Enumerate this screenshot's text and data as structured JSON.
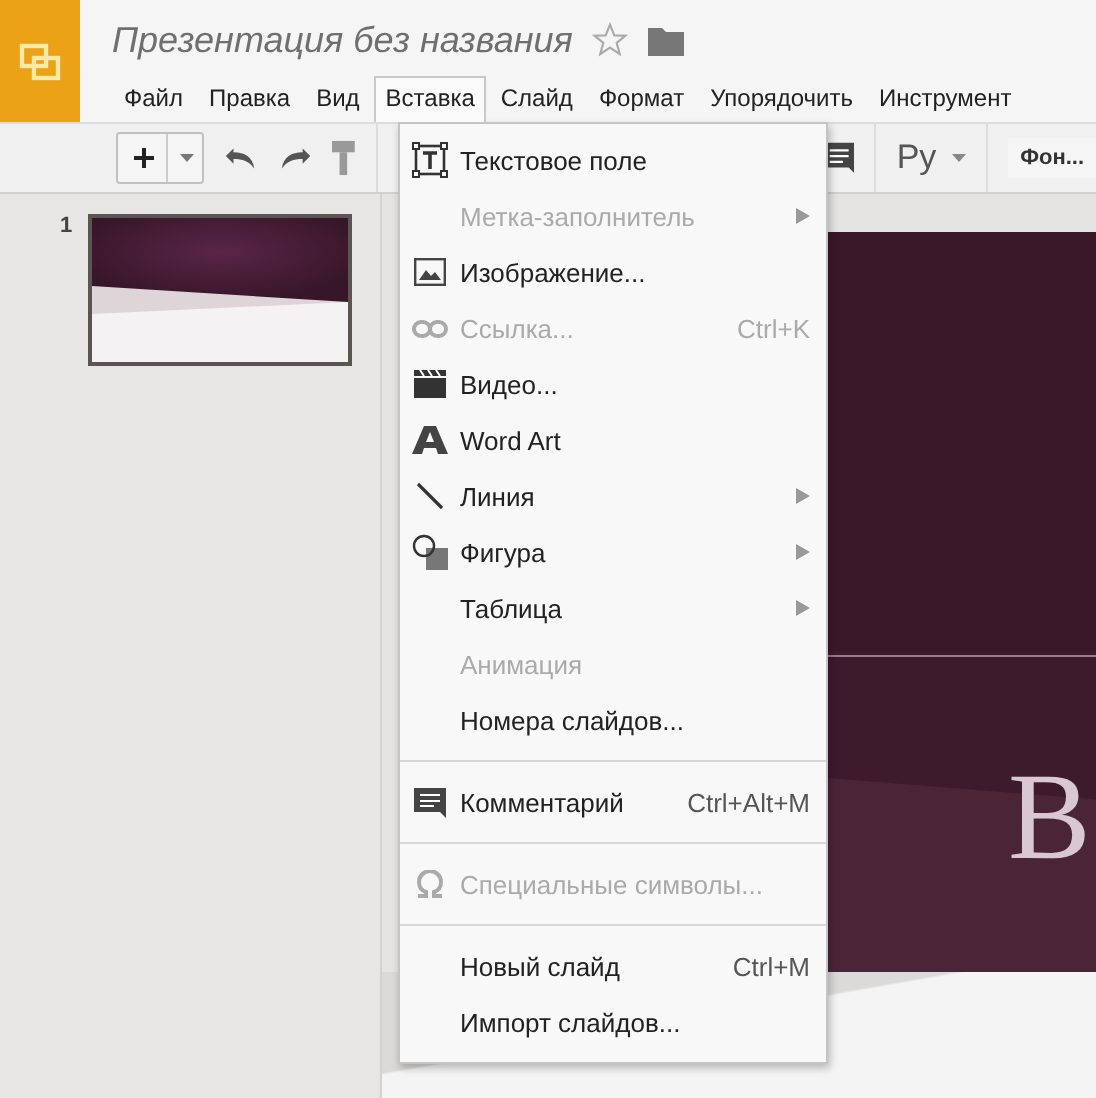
{
  "document": {
    "title": "Презентация без названия",
    "starred": false
  },
  "menu_bar": [
    {
      "label": "Файл",
      "selected": false
    },
    {
      "label": "Правка",
      "selected": false
    },
    {
      "label": "Вид",
      "selected": false
    },
    {
      "label": "Вставка",
      "selected": true
    },
    {
      "label": "Слайд",
      "selected": false
    },
    {
      "label": "Формат",
      "selected": false
    },
    {
      "label": "Упорядочить",
      "selected": false
    },
    {
      "label": "Инструмент",
      "selected": false
    }
  ],
  "toolbar": {
    "language": "Ру",
    "background_button": "Фон..."
  },
  "slides_panel": [
    {
      "number": "1",
      "selected": true
    }
  ],
  "slide": {
    "title_fragment": "В"
  },
  "insert_menu": [
    {
      "kind": "item",
      "label": "Текстовое поле",
      "disabled": false,
      "submenu": false
    },
    {
      "kind": "item",
      "label": "Метка-заполнитель",
      "disabled": true,
      "submenu": true
    },
    {
      "kind": "item",
      "label": "Изображение...",
      "disabled": false,
      "submenu": false
    },
    {
      "kind": "item",
      "label": "Ссылка...",
      "disabled": true,
      "submenu": false,
      "shortcut": "Ctrl+K"
    },
    {
      "kind": "item",
      "label": "Видео...",
      "disabled": false,
      "submenu": false
    },
    {
      "kind": "item",
      "label": "Word Art",
      "disabled": false,
      "submenu": false
    },
    {
      "kind": "item",
      "label": "Линия",
      "disabled": false,
      "submenu": true
    },
    {
      "kind": "item",
      "label": "Фигура",
      "disabled": false,
      "submenu": true
    },
    {
      "kind": "item",
      "label": "Таблица",
      "disabled": false,
      "submenu": true
    },
    {
      "kind": "item",
      "label": "Анимация",
      "disabled": true,
      "submenu": false
    },
    {
      "kind": "item",
      "label": "Номера слайдов...",
      "disabled": false,
      "submenu": false
    },
    {
      "kind": "separator"
    },
    {
      "kind": "item",
      "label": "Комментарий",
      "disabled": false,
      "submenu": false,
      "shortcut": "Ctrl+Alt+M"
    },
    {
      "kind": "separator"
    },
    {
      "kind": "item",
      "label": "Специальные символы...",
      "disabled": true,
      "submenu": false
    },
    {
      "kind": "separator"
    },
    {
      "kind": "item",
      "label": "Новый слайд",
      "disabled": false,
      "submenu": false,
      "shortcut": "Ctrl+M"
    },
    {
      "kind": "item",
      "label": "Импорт слайдов...",
      "disabled": false,
      "submenu": false
    }
  ]
}
